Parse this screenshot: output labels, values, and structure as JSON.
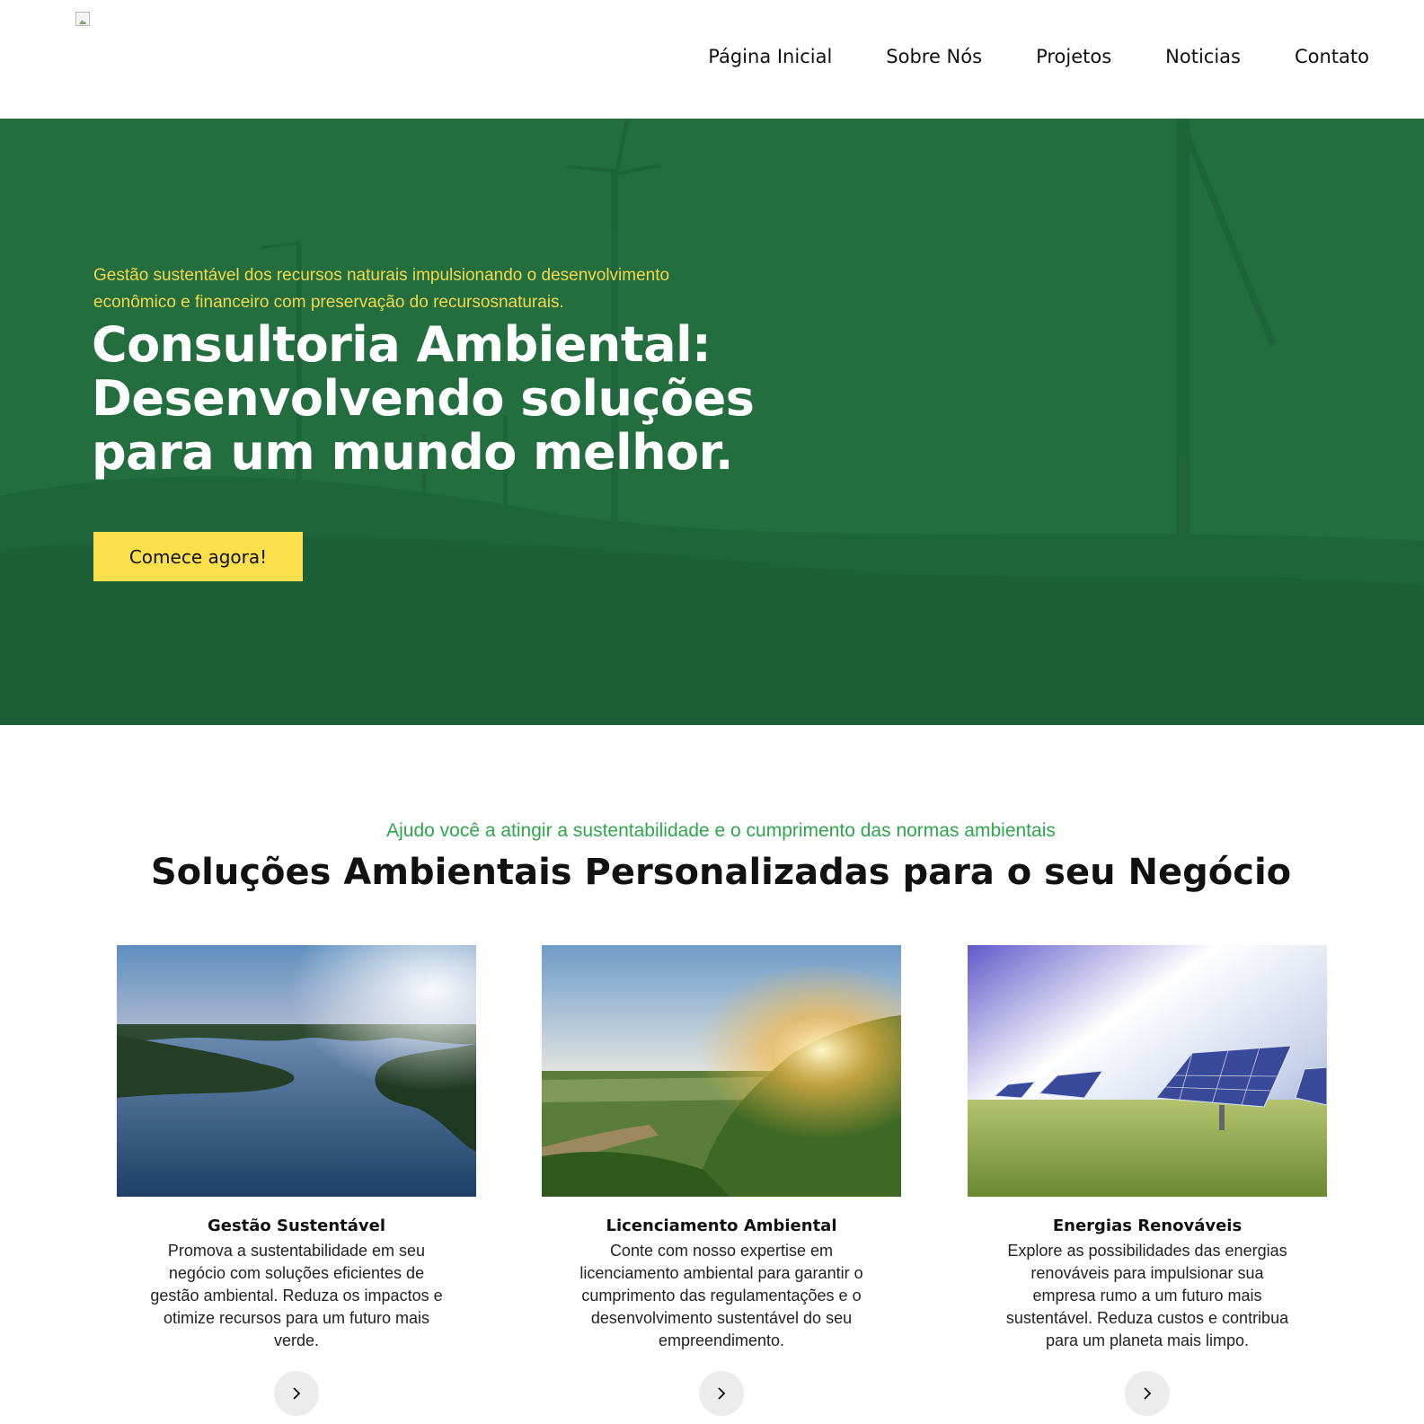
{
  "nav": {
    "items": [
      "Página Inicial",
      "Sobre Nós",
      "Projetos",
      "Noticias",
      "Contato"
    ]
  },
  "hero": {
    "subtitle": "Gestão sustentável dos recursos naturais impulsionando o desenvolvimento econômico e financeiro com preservação do recursosnaturais.",
    "title": "Consultoria Ambiental: Desenvolvendo soluções para um mundo melhor.",
    "cta": "Comece agora!"
  },
  "services": {
    "eyebrow": "Ajudo você a atingir a sustentabilidade e o cumprimento das normas ambientais",
    "title": "Soluções Ambientais Personalizadas para o seu Negócio",
    "cards": [
      {
        "title": "Gestão Sustentável",
        "text": "Promova a sustentabilidade em seu negócio com soluções eficientes de gestão ambiental. Reduza os impactos e otimize recursos para um futuro mais verde."
      },
      {
        "title": "Licenciamento Ambiental",
        "text": "Conte com nosso expertise em licenciamento ambiental para garantir o cumprimento das regulamentações e o desenvolvimento sustentável do seu empreendimento."
      },
      {
        "title": "Energias Renováveis",
        "text": "Explore as possibilidades das energias renováveis para impulsionar sua empresa rumo a um futuro mais sustentável. Reduza custos e contribua para um planeta mais limpo."
      }
    ]
  },
  "colors": {
    "hero_green": "#226e3f",
    "accent_yellow": "#fbe04c",
    "eyebrow_green": "#2fa64c"
  },
  "icons": {
    "logo": "broken-image-icon",
    "card_button": "chevron-right-icon"
  }
}
